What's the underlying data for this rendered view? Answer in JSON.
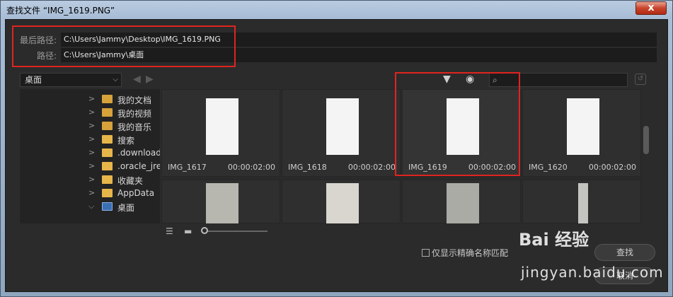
{
  "window": {
    "title": "查找文件 “IMG_1619.PNG”",
    "close_label": "x"
  },
  "paths": {
    "last_label": "最后路径:",
    "last_value": "C:\\Users\\Jammy\\Desktop\\IMG_1619.PNG",
    "current_label": "路径:",
    "current_value": "C:\\Users\\Jammy\\桌面"
  },
  "location": {
    "selected": "桌面"
  },
  "search": {
    "placeholder": ""
  },
  "tree": {
    "items": [
      {
        "label": "我的文档",
        "expanded": false,
        "icon": "documents-folder-icon"
      },
      {
        "label": "我的视频",
        "expanded": false,
        "icon": "videos-folder-icon"
      },
      {
        "label": "我的音乐",
        "expanded": false,
        "icon": "music-folder-icon"
      },
      {
        "label": "搜索",
        "expanded": false,
        "icon": "search-folder-icon"
      },
      {
        "label": ".download",
        "expanded": false,
        "icon": "folder-icon"
      },
      {
        "label": ".oracle_jre",
        "expanded": false,
        "icon": "folder-icon"
      },
      {
        "label": "收藏夹",
        "expanded": false,
        "icon": "favorites-folder-icon"
      },
      {
        "label": "AppData",
        "expanded": false,
        "icon": "folder-icon"
      },
      {
        "label": "桌面",
        "expanded": true,
        "icon": "desktop-folder-icon"
      }
    ]
  },
  "grid": {
    "tiles": [
      {
        "name": "IMG_1617",
        "duration": "00:00:02:00"
      },
      {
        "name": "IMG_1618",
        "duration": "00:00:02:00"
      },
      {
        "name": "IMG_1619",
        "duration": "00:00:02:00",
        "selected": true
      },
      {
        "name": "IMG_1620",
        "duration": "00:00:02:00"
      }
    ]
  },
  "options": {
    "exact_match_label": "仅显示精确名称匹配"
  },
  "buttons": {
    "find_label": "查找",
    "cancel_label": "取消"
  },
  "watermark": {
    "logo": "Bai 经验",
    "url": "jingyan.baidu.com"
  },
  "colors": {
    "highlight": "#e0241f",
    "dialog_bg": "#2b2b2b"
  }
}
